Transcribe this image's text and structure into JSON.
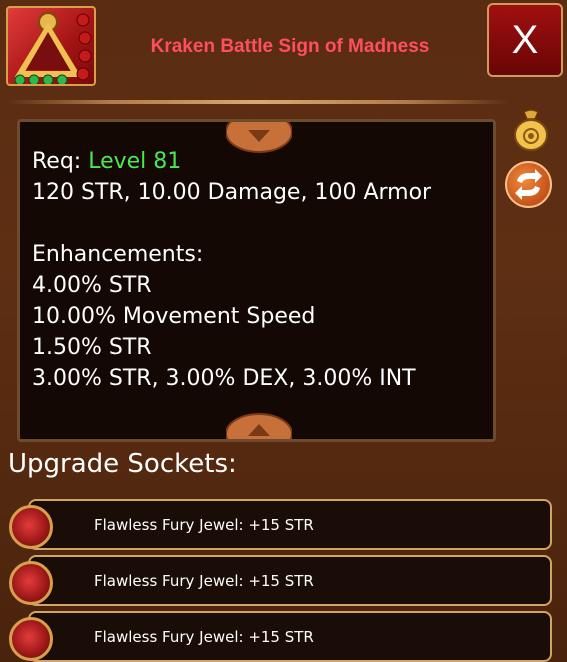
{
  "item": {
    "name": "Kraken Battle Sign of Madness",
    "icon": "pendant-icon"
  },
  "close_button": {
    "label": "X"
  },
  "side_buttons": [
    {
      "icon": "coin-bag-icon"
    },
    {
      "icon": "swap-arrows-icon"
    }
  ],
  "details": {
    "req_label": "Req:",
    "req_value": "Level 81",
    "base_stats": "120 STR, 10.00 Damage, 100 Armor",
    "enhancements_header": "Enhancements:",
    "enhancements": [
      "4.00% STR",
      "10.00% Movement Speed",
      "1.50% STR",
      "3.00% STR, 3.00% DEX, 3.00% INT"
    ]
  },
  "sockets": {
    "header": "Upgrade Sockets:",
    "items": [
      {
        "text": "Flawless Fury Jewel: +15 STR",
        "icon": "red-jewel-icon"
      },
      {
        "text": "Flawless Fury Jewel: +15 STR",
        "icon": "red-jewel-icon"
      },
      {
        "text": "Flawless Fury Jewel: +15 STR",
        "icon": "red-jewel-icon"
      }
    ]
  },
  "colors": {
    "title": "#ff4f5c",
    "req_level": "#4ce84c",
    "panel_bg": "#130804",
    "socket_border": "#d2a466"
  }
}
